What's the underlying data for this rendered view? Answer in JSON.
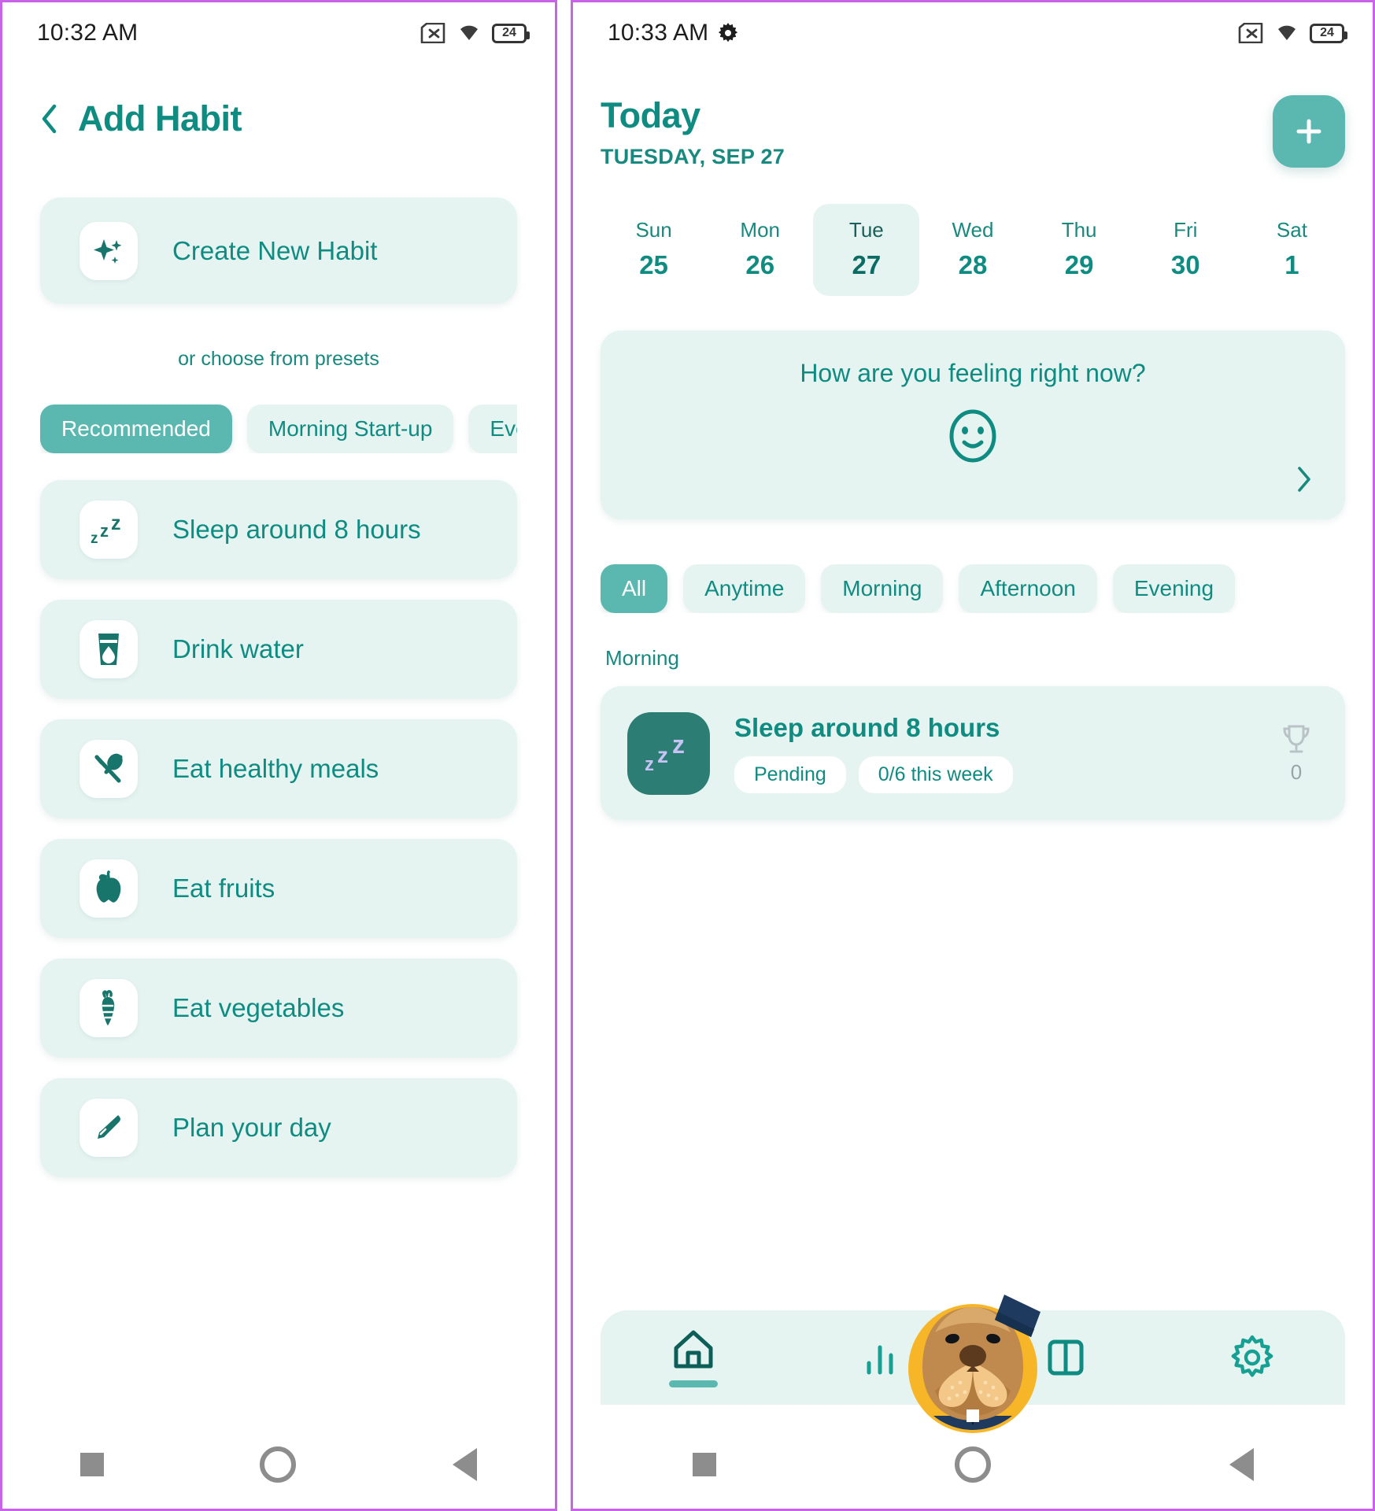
{
  "left": {
    "status": {
      "time": "10:32 AM",
      "battery": "24"
    },
    "header": {
      "back_icon": "chevron-left-icon",
      "title": "Add Habit"
    },
    "create": {
      "icon": "sparkles-icon",
      "label": "Create New Habit"
    },
    "presets_note": "or choose from presets",
    "preset_tabs": [
      {
        "label": "Recommended",
        "active": true
      },
      {
        "label": "Morning Start-up",
        "active": false
      },
      {
        "label": "Evening Ri",
        "active": false
      }
    ],
    "habits": [
      {
        "icon": "sleep-zzz-icon",
        "label": "Sleep around 8 hours"
      },
      {
        "icon": "water-glass-icon",
        "label": "Drink water"
      },
      {
        "icon": "cutlery-icon",
        "label": "Eat healthy meals"
      },
      {
        "icon": "apple-icon",
        "label": "Eat fruits"
      },
      {
        "icon": "carrot-icon",
        "label": "Eat vegetables"
      },
      {
        "icon": "pen-icon",
        "label": "Plan your day"
      }
    ]
  },
  "right": {
    "status": {
      "time": "10:33 AM",
      "gear_icon": "gear-icon",
      "battery": "24"
    },
    "header": {
      "title": "Today",
      "subtitle": "TUESDAY, SEP 27",
      "add_label": "+"
    },
    "week": [
      {
        "name": "Sun",
        "num": "25",
        "active": false
      },
      {
        "name": "Mon",
        "num": "26",
        "active": false
      },
      {
        "name": "Tue",
        "num": "27",
        "active": true
      },
      {
        "name": "Wed",
        "num": "28",
        "active": false
      },
      {
        "name": "Thu",
        "num": "29",
        "active": false
      },
      {
        "name": "Fri",
        "num": "30",
        "active": false
      },
      {
        "name": "Sat",
        "num": "1",
        "active": false
      }
    ],
    "mood": {
      "question": "How are you feeling right now?",
      "face_icon": "smiley-face-icon",
      "chevron_icon": "chevron-right-icon"
    },
    "filters": [
      {
        "label": "All",
        "active": true
      },
      {
        "label": "Anytime",
        "active": false
      },
      {
        "label": "Morning",
        "active": false
      },
      {
        "label": "Afternoon",
        "active": false
      },
      {
        "label": "Evening",
        "active": false
      }
    ],
    "section_label": "Morning",
    "habit_card": {
      "icon": "sleep-zzz-icon",
      "title": "Sleep around 8 hours",
      "status_badge": "Pending",
      "progress_badge": "0/6 this week",
      "trophy_icon": "trophy-icon",
      "trophy_count": "0"
    },
    "nav": [
      {
        "icon": "home-icon",
        "active": true
      },
      {
        "icon": "stats-icon",
        "active": false
      },
      {
        "icon": "book-icon",
        "active": false
      },
      {
        "icon": "gear-icon",
        "active": false
      }
    ],
    "mascot_icon": "beaver-mascot-icon"
  },
  "colors": {
    "accent": "#0f8c82",
    "accent_light": "#5bb8b0",
    "card_bg": "#e6f4f1",
    "avatar_bg": "#2c7d74"
  }
}
